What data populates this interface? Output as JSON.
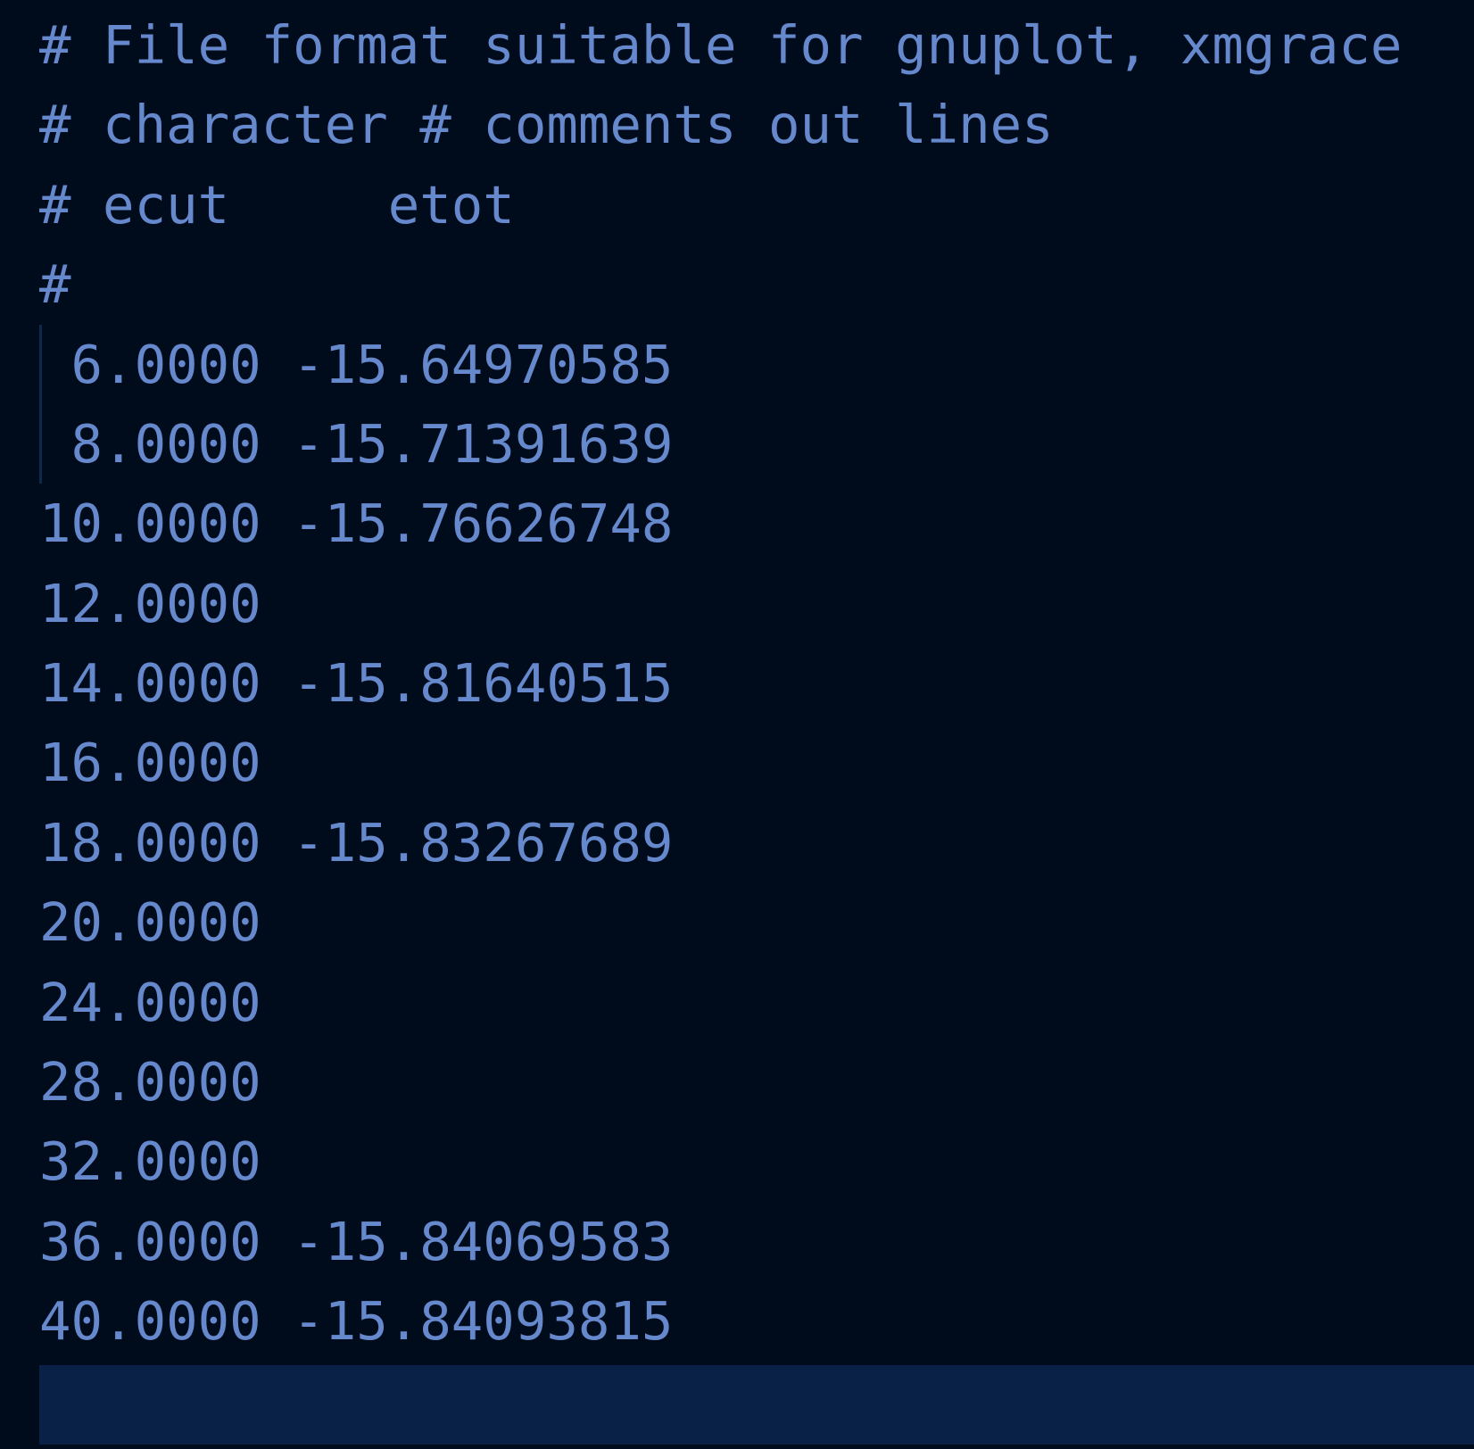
{
  "editor": {
    "theme": {
      "background": "#000c1b",
      "text": "#6688cc",
      "current_line": "#092047",
      "indent_guide": "#0e2a4a"
    },
    "lines": [
      "# File format suitable for gnuplot, xmgrace",
      "# character # comments out lines",
      "# ecut     etot",
      "#",
      " 6.0000 -15.64970585",
      " 8.0000 -15.71391639",
      "10.0000 -15.76626748",
      "12.0000",
      "14.0000 -15.81640515",
      "16.0000",
      "18.0000 -15.83267689",
      "20.0000",
      "24.0000",
      "28.0000",
      "32.0000",
      "36.0000 -15.84069583",
      "40.0000 -15.84093815",
      ""
    ]
  }
}
